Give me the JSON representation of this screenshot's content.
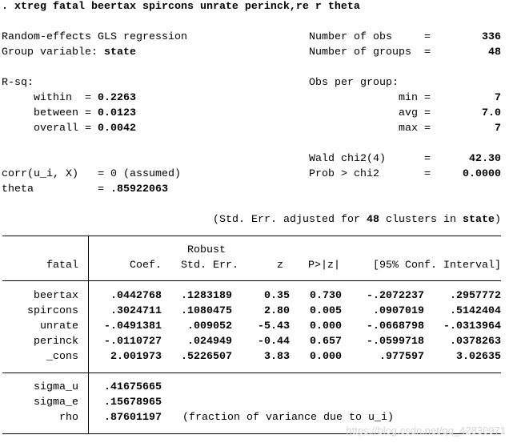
{
  "command": ". xtreg fatal beertax spircons unrate perinck,re r theta",
  "header": {
    "model": "Random-effects GLS regression",
    "group_var_label": "Group variable:",
    "group_var": "state",
    "rsq_label": "R-sq:",
    "rsq": [
      {
        "label": "within",
        "value": "0.2263"
      },
      {
        "label": "between",
        "value": "0.0123"
      },
      {
        "label": "overall",
        "value": "0.0042"
      }
    ],
    "corr_label": "corr(u_i, X)",
    "corr_value": "0 (assumed)",
    "theta_label": "theta",
    "theta_value": ".85922063",
    "n_obs_label": "Number of obs",
    "n_obs": "336",
    "n_groups_label": "Number of groups",
    "n_groups": "48",
    "obs_per_group_label": "Obs per group:",
    "obs_per_group": [
      {
        "label": "min",
        "value": "7"
      },
      {
        "label": "avg",
        "value": "7.0"
      },
      {
        "label": "max",
        "value": "7"
      }
    ],
    "wald_label": "Wald chi2(4)",
    "wald": "42.30",
    "prob_label": "Prob > chi2",
    "prob": "0.0000",
    "cluster_note_pre": "(Std. Err. adjusted for ",
    "cluster_n": "48",
    "cluster_note_mid": " clusters in ",
    "cluster_var": "state",
    "cluster_note_post": ")"
  },
  "table": {
    "depvar": "fatal",
    "robust_label": "Robust",
    "columns": [
      "Coef.",
      "Std. Err.",
      "z",
      "P>|z|",
      "[95% Conf. Interval]"
    ],
    "rows": [
      {
        "var": "beertax",
        "coef": ".0442768",
        "se": ".1283189",
        "z": "0.35",
        "p": "0.730",
        "lo": "-.2072237",
        "hi": ".2957772"
      },
      {
        "var": "spircons",
        "coef": ".3024711",
        "se": ".1080475",
        "z": "2.80",
        "p": "0.005",
        "lo": ".0907019",
        "hi": ".5142404"
      },
      {
        "var": "unrate",
        "coef": "-.0491381",
        "se": ".009052",
        "z": "-5.43",
        "p": "0.000",
        "lo": "-.0668798",
        "hi": "-.0313964"
      },
      {
        "var": "perinck",
        "coef": "-.0110727",
        "se": ".024949",
        "z": "-0.44",
        "p": "0.657",
        "lo": "-.0599718",
        "hi": ".0378263"
      },
      {
        "var": "_cons",
        "coef": "2.001973",
        "se": ".5226507",
        "z": "3.83",
        "p": "0.000",
        "lo": ".977597",
        "hi": "3.02635"
      }
    ],
    "variance": [
      {
        "label": "sigma_u",
        "value": ".41675665"
      },
      {
        "label": "sigma_e",
        "value": ".15678965"
      },
      {
        "label": "rho",
        "value": ".87601197",
        "note": "(fraction of variance due to u_i)"
      }
    ]
  },
  "watermark": "https://blog.csdn.net/qq_42830971"
}
